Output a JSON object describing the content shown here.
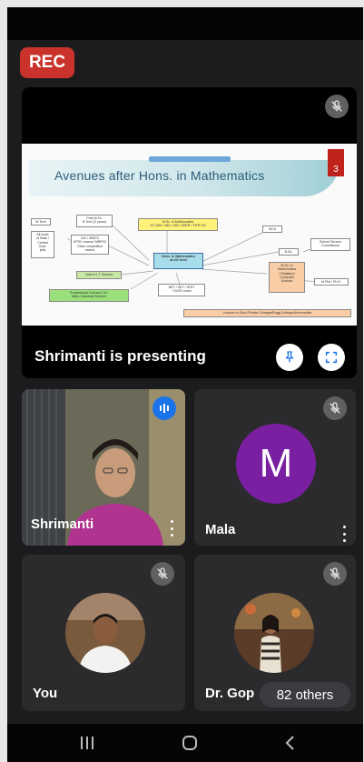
{
  "recording": {
    "label": "REC",
    "color": "#c9332b"
  },
  "presentation": {
    "status_text": "Shrimanti is presenting",
    "slide": {
      "title": "Avenues after Hons. in Mathematics",
      "number": "3",
      "nodes": {
        "msc_math": "M.Sc. in Mathematics\nIIT-JAM / JNU / IISc / IISER / TIFR GS",
        "hons": "Hons. in Mathematics\nat UG level",
        "btech": "Post M.Sc.\nB.Tech (2 years)",
        "mtech": "M.Tech",
        "ias": "IAS / WBCS\nUPSC exams/ WBPSC\nOther competitive\nexams",
        "govt": "All kinds\nof State /\nCentral\nGovt.\njobs",
        "it": "Jobs in I.T. Sectors",
        "prof": "Professional Courses CA /\nMBA / Actuarial Science",
        "net": "NET / SET / JEST\n/ GATE exam",
        "mca": "MCA",
        "bed": "B.Ed.",
        "ssc": "School Service\nCommission",
        "msc_stat": "M.Sc. in\nMathematics\n/ Statistics/\nComputer\nScience",
        "mphil": "M.Phil / Ph.D.",
        "lecturer": "Lecturer in Govt./Private Colleges/Engg.Colleges/Universities"
      }
    }
  },
  "participants": [
    {
      "name": "Shrimanti",
      "speaking": true
    },
    {
      "name": "Mala",
      "initial": "M",
      "avatar_color": "#7b1fa2"
    },
    {
      "name": "You"
    },
    {
      "name": "Dr. Gop",
      "others_label": "82 others"
    }
  ],
  "icons": {
    "mic_off": "mic-off-icon",
    "pin": "pin-icon",
    "fullscreen": "fullscreen-icon",
    "speaking": "audio-level-icon"
  },
  "colors": {
    "background": "#1c1c1f",
    "tile": "#2b2b2e",
    "accent": "#1a73e8"
  }
}
